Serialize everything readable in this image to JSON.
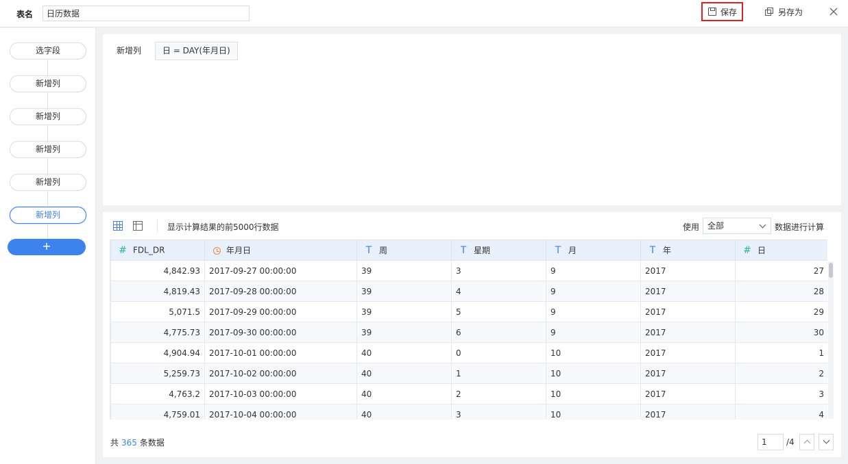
{
  "header": {
    "table_name_label": "表名",
    "table_name_value": "日历数据",
    "save_label": "保存",
    "save_as_label": "另存为"
  },
  "sidebar": {
    "steps": [
      {
        "label": "选字段"
      },
      {
        "label": "新增列"
      },
      {
        "label": "新增列"
      },
      {
        "label": "新增列"
      },
      {
        "label": "新增列"
      },
      {
        "label": "新增列",
        "active": true
      }
    ],
    "add_label": "+"
  },
  "formula": {
    "label": "新增列",
    "expression": "日 = DAY(年月日)"
  },
  "data_panel": {
    "info_text": "显示计算结果的前5000行数据",
    "use_label": "使用",
    "use_select_value": "全部",
    "use_suffix": "数据进行计算",
    "columns": [
      {
        "name": "FDL_DR",
        "type": "number"
      },
      {
        "name": "年月日",
        "type": "date"
      },
      {
        "name": "周",
        "type": "text"
      },
      {
        "name": "星期",
        "type": "text"
      },
      {
        "name": "月",
        "type": "text"
      },
      {
        "name": "年",
        "type": "text"
      },
      {
        "name": "日",
        "type": "number"
      }
    ],
    "rows": [
      [
        "4,842.93",
        "2017-09-27 00:00:00",
        "39",
        "3",
        "9",
        "2017",
        "27"
      ],
      [
        "4,819.43",
        "2017-09-28 00:00:00",
        "39",
        "4",
        "9",
        "2017",
        "28"
      ],
      [
        "5,071.5",
        "2017-09-29 00:00:00",
        "39",
        "5",
        "9",
        "2017",
        "29"
      ],
      [
        "4,775.73",
        "2017-09-30 00:00:00",
        "39",
        "6",
        "9",
        "2017",
        "30"
      ],
      [
        "4,904.94",
        "2017-10-01 00:00:00",
        "40",
        "0",
        "10",
        "2017",
        "1"
      ],
      [
        "5,259.73",
        "2017-10-02 00:00:00",
        "40",
        "1",
        "10",
        "2017",
        "2"
      ],
      [
        "4,763.2",
        "2017-10-03 00:00:00",
        "40",
        "2",
        "10",
        "2017",
        "3"
      ],
      [
        "4,759.01",
        "2017-10-04 00:00:00",
        "40",
        "3",
        "10",
        "2017",
        "4"
      ]
    ],
    "footer": {
      "prefix": "共",
      "count": "365",
      "suffix": "条数据",
      "page_value": "1",
      "page_total": "/4"
    }
  },
  "icons": {
    "number_type": "number-type-icon",
    "text_type": "text-type-icon",
    "date_type": "date-type-icon"
  },
  "colors": {
    "accent": "#3e82ee",
    "save_highlight": "#e02020",
    "header_bg": "#e8f0fb"
  }
}
